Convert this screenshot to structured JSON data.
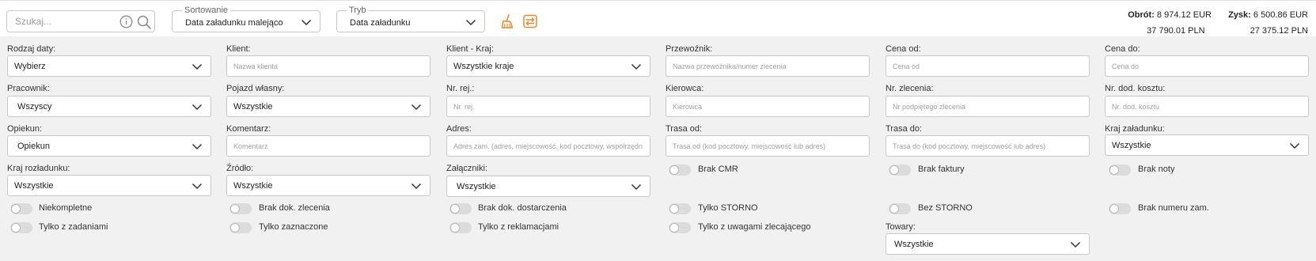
{
  "search": {
    "placeholder": "Szukaj..."
  },
  "sort": {
    "legend": "Sortowanie",
    "value": "Data załadunku malejąco"
  },
  "mode": {
    "legend": "Tryb",
    "value": "Data załadunku"
  },
  "totals": {
    "turnover_label": "Obrót:",
    "turnover_eur": "8 974.12 EUR",
    "turnover_pln": "37 790.01 PLN",
    "profit_label": "Zysk:",
    "profit_eur": "6 500.86 EUR",
    "profit_pln": "27 375.12 PLN"
  },
  "colors": {
    "accent_orange": "#e8892f"
  },
  "icons": {
    "info": "info-icon",
    "search": "search-icon",
    "clear": "broom-icon",
    "swap": "swap-icon"
  },
  "filters": {
    "date_type": {
      "label": "Rodzaj daty:",
      "value": "Wybierz"
    },
    "client": {
      "label": "Klient:",
      "placeholder": "Nazwa klienta"
    },
    "client_country": {
      "label": "Klient - Kraj:",
      "value": "Wszystkie kraje"
    },
    "carrier": {
      "label": "Przewoźnik:",
      "placeholder": "Nazwa przewoźnika/numer zlecenia"
    },
    "price_from": {
      "label": "Cena od:",
      "placeholder": "Cena od"
    },
    "price_to": {
      "label": "Cena do:",
      "placeholder": "Cena do"
    },
    "employee": {
      "label": "Pracownik:",
      "value": "Wszyscy"
    },
    "own_vehicle": {
      "label": "Pojazd własny:",
      "value": "Wszystkie"
    },
    "reg_no": {
      "label": "Nr. rej.:",
      "placeholder": "Nr. rej."
    },
    "driver": {
      "label": "Kierowca:",
      "placeholder": "Kierowca"
    },
    "order_no": {
      "label": "Nr. zlecenia:",
      "placeholder": "Nr podpiętego zlecenia"
    },
    "extra_cost_no": {
      "label": "Nr. dod. kosztu:",
      "placeholder": "Nr. dod. kosztu"
    },
    "guardian": {
      "label": "Opiekun:",
      "value": "Opiekun"
    },
    "comment": {
      "label": "Komentarz:",
      "placeholder": "Komentarz"
    },
    "address": {
      "label": "Adres:",
      "placeholder": "Adres zam. (adres, miejscowość, kod pocztowy, współrzędn"
    },
    "route_from": {
      "label": "Trasa od:",
      "placeholder": "Trasa od (kod pocztowy, miejscowość lub adres)"
    },
    "route_to": {
      "label": "Trasa do:",
      "placeholder": "Trasa do (kod pocztowy, miejscowość lub adres)"
    },
    "loading_country": {
      "label": "Kraj załadunku:",
      "value": "Wszystkie"
    },
    "unloading_country": {
      "label": "Kraj rozładunku:",
      "value": "Wszystkie"
    },
    "source": {
      "label": "Źródło:",
      "value": "Wszystkie"
    },
    "attachments": {
      "label": "Załączniki:",
      "value": "Wszystkie"
    },
    "goods": {
      "label": "Towary:",
      "value": "Wszystkie"
    }
  },
  "toggles": {
    "no_cmr": "Brak CMR",
    "no_invoice": "Brak faktury",
    "no_note": "Brak noty",
    "incomplete": "Niekompletne",
    "no_order_doc": "Brak dok. zlecenia",
    "no_delivery_doc": "Brak dok. dostarczenia",
    "only_storno": "Tylko STORNO",
    "without_storno": "Bez STORNO",
    "no_order_number": "Brak numeru zam.",
    "only_with_tasks": "Tylko z zadaniami",
    "only_marked": "Tylko zaznaczone",
    "only_with_complaints": "Tylko z reklamacjami",
    "only_with_principal_remarks": "Tylko z uwagami zlecającego"
  }
}
